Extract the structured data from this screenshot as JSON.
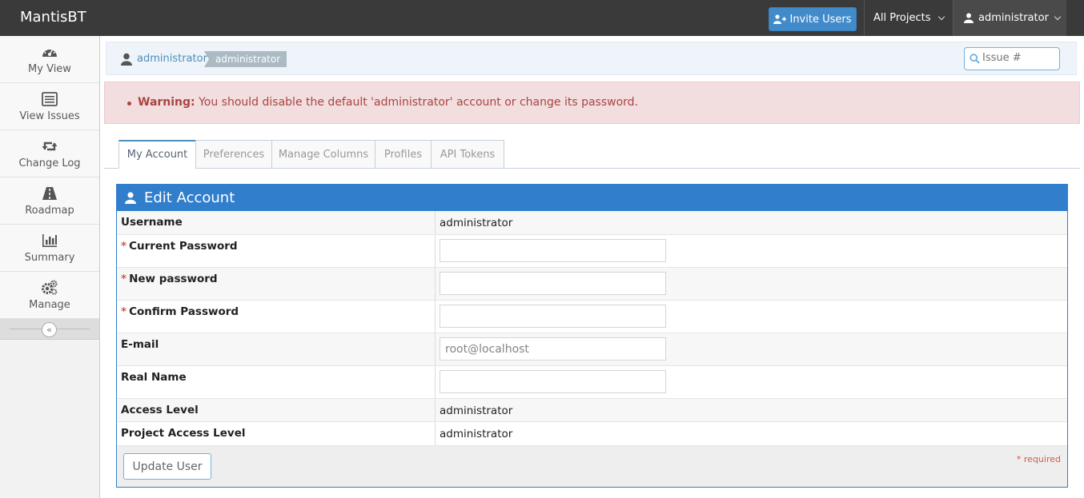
{
  "navbar": {
    "brand": "MantisBT",
    "invite_label": "Invite Users",
    "projects_label": "All Projects",
    "user_label": "administrator"
  },
  "sidebar": {
    "items": [
      {
        "label": "My View",
        "icon": "dashboard-icon"
      },
      {
        "label": "View Issues",
        "icon": "list-icon"
      },
      {
        "label": "Change Log",
        "icon": "retweet-icon"
      },
      {
        "label": "Roadmap",
        "icon": "road-icon"
      },
      {
        "label": "Summary",
        "icon": "bar-chart-icon"
      },
      {
        "label": "Manage",
        "icon": "gears-icon"
      }
    ]
  },
  "breadcrumb": {
    "user_link": "administrator",
    "access_badge": "administrator",
    "search_placeholder": "Issue #"
  },
  "alert": {
    "title": "Warning:",
    "message": " You should disable the default 'administrator' account or change its password."
  },
  "tabs": [
    {
      "label": "My Account",
      "active": true
    },
    {
      "label": "Preferences"
    },
    {
      "label": "Manage Columns"
    },
    {
      "label": "Profiles"
    },
    {
      "label": "API Tokens"
    }
  ],
  "form": {
    "title": "Edit Account",
    "username_label": "Username",
    "username_value": "administrator",
    "current_password_label": "Current Password",
    "new_password_label": "New password",
    "confirm_password_label": "Confirm Password",
    "email_label": "E-mail",
    "email_value": "root@localhost",
    "realname_label": "Real Name",
    "realname_value": "",
    "access_level_label": "Access Level",
    "access_level_value": "administrator",
    "project_access_label": "Project Access Level",
    "project_access_value": "administrator",
    "required_star": "*",
    "submit_label": "Update User",
    "required_note": "* required"
  },
  "colors": {
    "navbar": "#3a3a3a",
    "accent": "#307ecc",
    "invite_button": "#428bca",
    "alert_bg": "#f2dede",
    "alert_text": "#a94442"
  }
}
